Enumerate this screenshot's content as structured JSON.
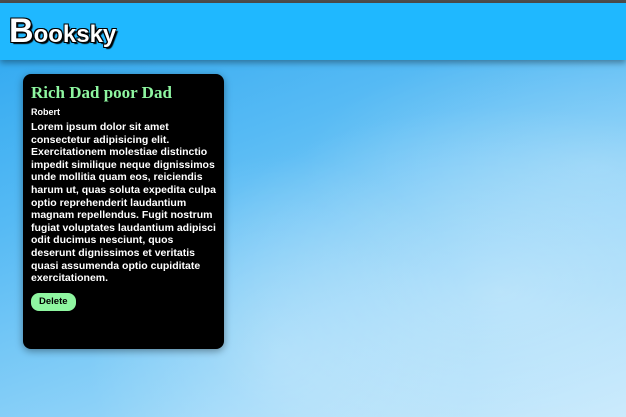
{
  "header": {
    "logo_first_letter": "B",
    "logo_rest": "ooksky"
  },
  "books": [
    {
      "title": "Rich Dad poor Dad",
      "author": "Robert",
      "description": "Lorem ipsum dolor sit amet consectetur adipisicing elit. Exercitationem molestiae distinctio impedit similique neque dignissimos unde mollitia quam eos, reiciendis harum ut, quas soluta expedita culpa optio reprehenderit laudantium magnam repellendus. Fugit nostrum fugiat voluptates laudantium adipisci odit ducimus nesciunt, quos deserunt dignissimos et veritatis quasi assumenda optio cupiditate exercitationem.",
      "delete_label": "Delete"
    }
  ],
  "colors": {
    "header_background": "#1fb8ff",
    "card_background": "#000000",
    "accent_green": "#8ef6a0"
  }
}
